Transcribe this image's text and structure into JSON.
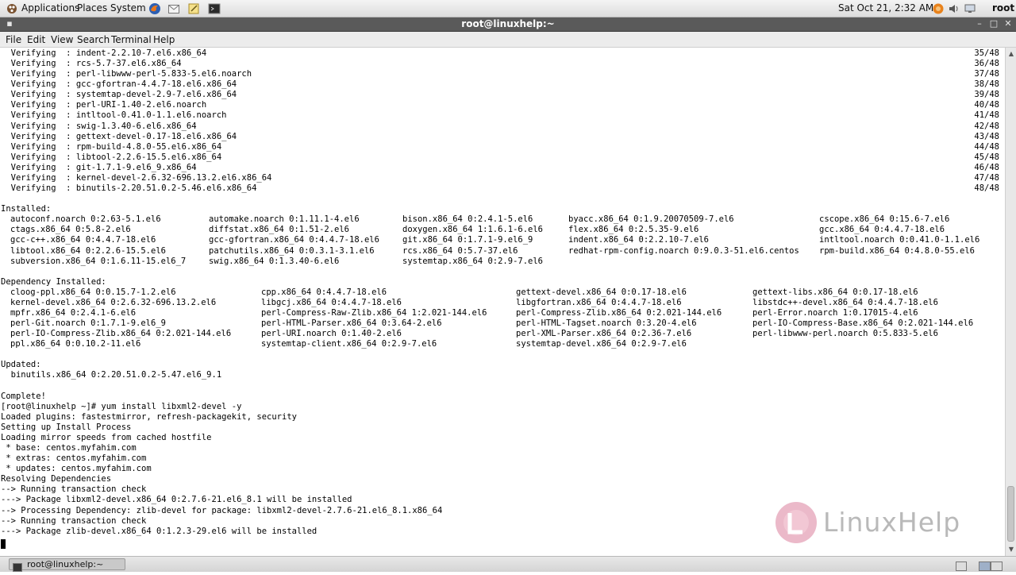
{
  "top_panel": {
    "applications": "Applications",
    "places": "Places",
    "system": "System",
    "clock": "Sat Oct 21,  2:32 AM",
    "user": "root",
    "icons": [
      "applications-icon",
      "firefox-icon",
      "mail-icon",
      "notes-icon",
      "terminal-launcher-icon",
      "update-icon",
      "volume-icon",
      "network-icon"
    ]
  },
  "window": {
    "title": "root@linuxhelp:~",
    "menu": [
      "File",
      "Edit",
      "View",
      "Search",
      "Terminal",
      "Help"
    ]
  },
  "terminal": {
    "lines": [
      "  Verifying  : indent-2.2.10-7.el6.x86_64",
      "  Verifying  : rcs-5.7-37.el6.x86_64",
      "  Verifying  : perl-libwww-perl-5.833-5.el6.noarch",
      "  Verifying  : gcc-gfortran-4.4.7-18.el6.x86_64",
      "  Verifying  : systemtap-devel-2.9-7.el6.x86_64",
      "  Verifying  : perl-URI-1.40-2.el6.noarch",
      "  Verifying  : intltool-0.41.0-1.1.el6.noarch",
      "  Verifying  : swig-1.3.40-6.el6.x86_64",
      "  Verifying  : gettext-devel-0.17-18.el6.x86_64",
      "  Verifying  : rpm-build-4.8.0-55.el6.x86_64",
      "  Verifying  : libtool-2.2.6-15.5.el6.x86_64",
      "  Verifying  : git-1.7.1-9.el6_9.x86_64",
      "  Verifying  : kernel-devel-2.6.32-696.13.2.el6.x86_64",
      "  Verifying  : binutils-2.20.51.0.2-5.46.el6.x86_64",
      "",
      "Installed:",
      "",
      "",
      "",
      "",
      "",
      "",
      "Dependency Installed:",
      "",
      "",
      "",
      "",
      "",
      "",
      "",
      "Updated:",
      "  binutils.x86_64 0:2.20.51.0.2-5.47.el6_9.1",
      "",
      "Complete!",
      "[root@linuxhelp ~]# yum install libxml2-devel -y",
      "Loaded plugins: fastestmirror, refresh-packagekit, security",
      "Setting up Install Process",
      "Loading mirror speeds from cached hostfile",
      " * base: centos.myfahim.com",
      " * extras: centos.myfahim.com",
      " * updates: centos.myfahim.com",
      "Resolving Dependencies",
      "--> Running transaction check",
      "---> Package libxml2-devel.x86_64 0:2.7.6-21.el6_8.1 will be installed",
      "--> Processing Dependency: zlib-devel for package: libxml2-devel-2.7.6-21.el6_8.1.x86_64",
      "--> Running transaction check",
      "---> Package zlib-devel.x86_64 0:1.2.3-29.el6 will be installed"
    ],
    "progress_counts": [
      "35/48",
      "36/48",
      "37/48",
      "38/48",
      "39/48",
      "40/48",
      "41/48",
      "42/48",
      "43/48",
      "44/48",
      "45/48",
      "46/48",
      "47/48",
      "48/48"
    ],
    "installed_rows": [
      [
        "autoconf.noarch 0:2.63-5.1.el6",
        "automake.noarch 0:1.11.1-4.el6",
        "bison.x86_64 0:2.4.1-5.el6",
        "byacc.x86_64 0:1.9.20070509-7.el6",
        "cscope.x86_64 0:15.6-7.el6"
      ],
      [
        "ctags.x86_64 0:5.8-2.el6",
        "diffstat.x86_64 0:1.51-2.el6",
        "doxygen.x86_64 1:1.6.1-6.el6",
        "flex.x86_64 0:2.5.35-9.el6",
        "gcc.x86_64 0:4.4.7-18.el6"
      ],
      [
        "gcc-c++.x86_64 0:4.4.7-18.el6",
        "gcc-gfortran.x86_64 0:4.4.7-18.el6",
        "git.x86_64 0:1.7.1-9.el6_9",
        "indent.x86_64 0:2.2.10-7.el6",
        "intltool.noarch 0:0.41.0-1.1.el6"
      ],
      [
        "libtool.x86_64 0:2.2.6-15.5.el6",
        "patchutils.x86_64 0:0.3.1-3.1.el6",
        "rcs.x86_64 0:5.7-37.el6",
        "redhat-rpm-config.noarch 0:9.0.3-51.el6.centos",
        "rpm-build.x86_64 0:4.8.0-55.el6"
      ],
      [
        "subversion.x86_64 0:1.6.11-15.el6_7",
        "swig.x86_64 0:1.3.40-6.el6",
        "systemtap.x86_64 0:2.9-7.el6",
        "",
        ""
      ]
    ],
    "dependency_rows": [
      [
        "cloog-ppl.x86_64 0:0.15.7-1.2.el6",
        "cpp.x86_64 0:4.4.7-18.el6",
        "gettext-devel.x86_64 0:0.17-18.el6",
        "gettext-libs.x86_64 0:0.17-18.el6"
      ],
      [
        "kernel-devel.x86_64 0:2.6.32-696.13.2.el6",
        "libgcj.x86_64 0:4.4.7-18.el6",
        "libgfortran.x86_64 0:4.4.7-18.el6",
        "libstdc++-devel.x86_64 0:4.4.7-18.el6"
      ],
      [
        "mpfr.x86_64 0:2.4.1-6.el6",
        "perl-Compress-Raw-Zlib.x86_64 1:2.021-144.el6",
        "perl-Compress-Zlib.x86_64 0:2.021-144.el6",
        "perl-Error.noarch 1:0.17015-4.el6"
      ],
      [
        "perl-Git.noarch 0:1.7.1-9.el6_9",
        "perl-HTML-Parser.x86_64 0:3.64-2.el6",
        "perl-HTML-Tagset.noarch 0:3.20-4.el6",
        "perl-IO-Compress-Base.x86_64 0:2.021-144.el6"
      ],
      [
        "perl-IO-Compress-Zlib.x86_64 0:2.021-144.el6",
        "perl-URI.noarch 0:1.40-2.el6",
        "perl-XML-Parser.x86_64 0:2.36-7.el6",
        "perl-libwww-perl.noarch 0:5.833-5.el6"
      ],
      [
        "ppl.x86_64 0:0.10.2-11.el6",
        "systemtap-client.x86_64 0:2.9-7.el6",
        "systemtap-devel.x86_64 0:2.9-7.el6",
        ""
      ]
    ]
  },
  "watermark": {
    "text": "LinuxHelp"
  },
  "taskbar": {
    "window_label": "root@linuxhelp:~"
  }
}
